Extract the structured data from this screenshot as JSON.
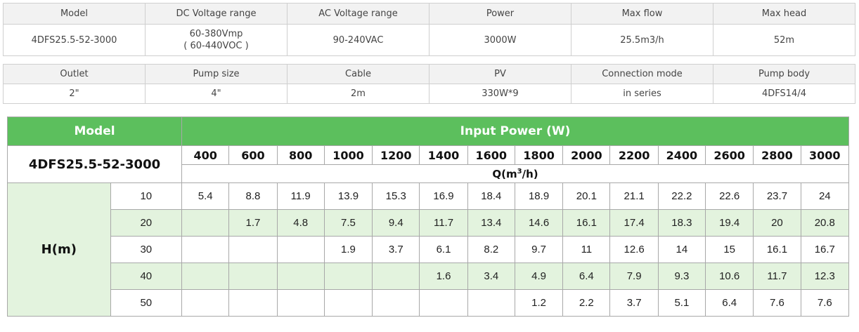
{
  "spec1": {
    "headers": [
      "Model",
      "DC Voltage range",
      "AC Voltage range",
      "Power",
      "Max flow",
      "Max head"
    ],
    "values": {
      "model": "4DFS25.5-52-3000",
      "dc_line1": "60-380Vmp",
      "dc_line2": "( 60-440VOC )",
      "ac": "90-240VAC",
      "power": "3000W",
      "max_flow": "25.5m3/h",
      "max_head": "52m"
    }
  },
  "spec2": {
    "headers": [
      "Outlet",
      "Pump size",
      "Cable",
      "PV",
      "Connection mode",
      "Pump body"
    ],
    "values": [
      "2\"",
      "4\"",
      "2m",
      "330W*9",
      "in series",
      "4DFS14/4"
    ]
  },
  "perf": {
    "model_header": "Model",
    "power_header": "Input Power (W)",
    "model_name": "4DFS25.5-52-3000",
    "flow_unit_prefix": "Q(m",
    "flow_unit_sup": "3",
    "flow_unit_suffix": "/h)",
    "head_label": "H(m)",
    "powers": [
      "400",
      "600",
      "800",
      "1000",
      "1200",
      "1400",
      "1600",
      "1800",
      "2000",
      "2200",
      "2400",
      "2600",
      "2800",
      "3000"
    ],
    "rows": [
      {
        "head": "10",
        "values": [
          "5.4",
          "8.8",
          "11.9",
          "13.9",
          "15.3",
          "16.9",
          "18.4",
          "18.9",
          "20.1",
          "21.1",
          "22.2",
          "22.6",
          "23.7",
          "24"
        ]
      },
      {
        "head": "20",
        "values": [
          "",
          "1.7",
          "4.8",
          "7.5",
          "9.4",
          "11.7",
          "13.4",
          "14.6",
          "16.1",
          "17.4",
          "18.3",
          "19.4",
          "20",
          "20.8"
        ]
      },
      {
        "head": "30",
        "values": [
          "",
          "",
          "",
          "1.9",
          "3.7",
          "6.1",
          "8.2",
          "9.7",
          "11",
          "12.6",
          "14",
          "15",
          "16.1",
          "16.7"
        ]
      },
      {
        "head": "40",
        "values": [
          "",
          "",
          "",
          "",
          "",
          "1.6",
          "3.4",
          "4.9",
          "6.4",
          "7.9",
          "9.3",
          "10.6",
          "11.7",
          "12.3"
        ]
      },
      {
        "head": "50",
        "values": [
          "",
          "",
          "",
          "",
          "",
          "",
          "",
          "1.2",
          "2.2",
          "3.7",
          "5.1",
          "6.4",
          "7.6",
          "7.6"
        ]
      }
    ]
  },
  "colors": {
    "header_green": "#5cbf5d",
    "row_shade": "#e3f3de",
    "spec_header_gray": "#f2f2f2"
  }
}
